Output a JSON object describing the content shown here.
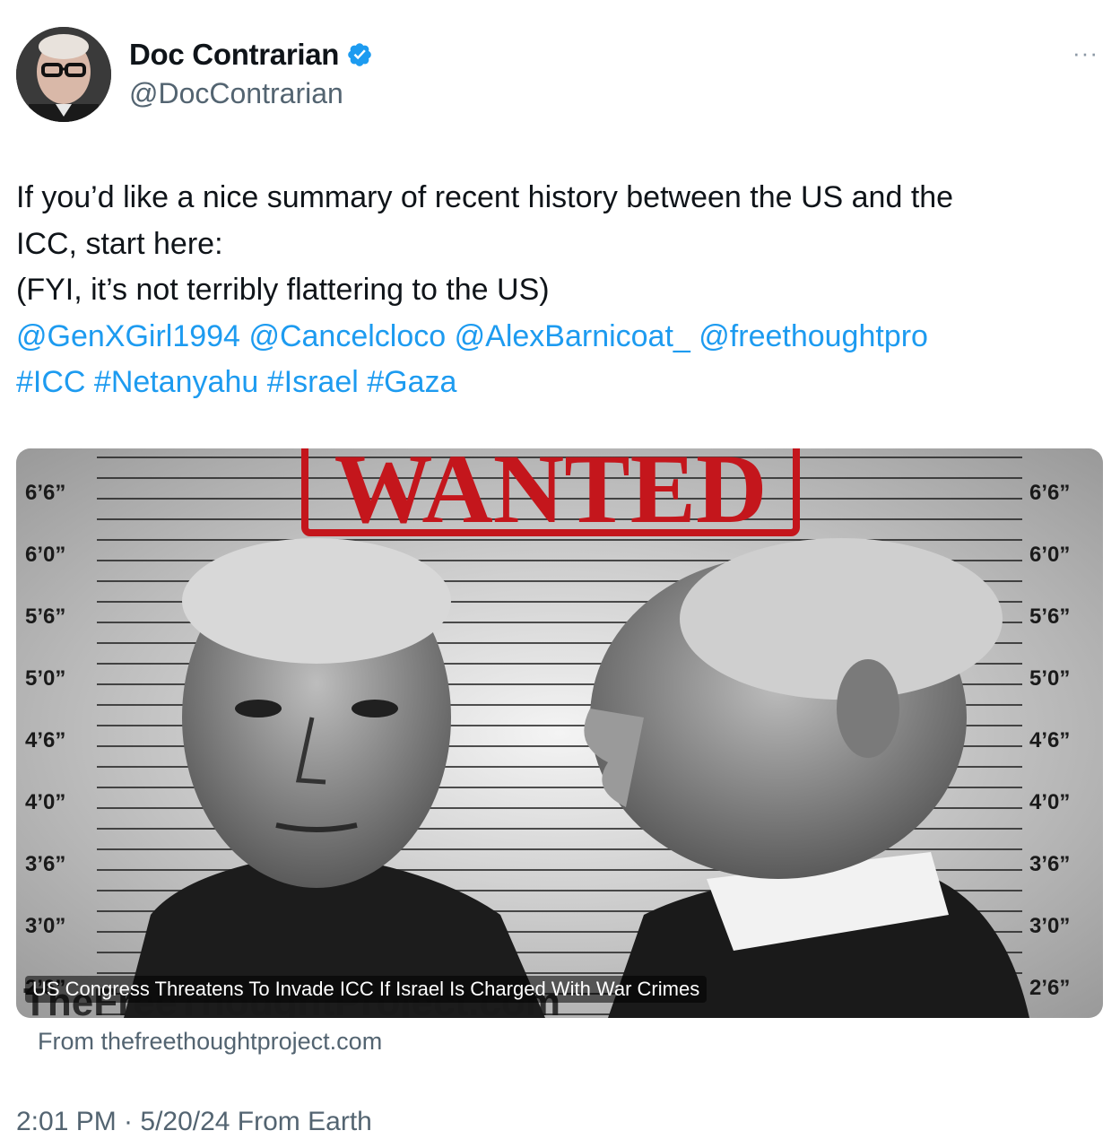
{
  "author": {
    "display_name": "Doc Contrarian",
    "handle": "@DocContrarian"
  },
  "more_label": "···",
  "tweet": {
    "line1": "If you’d like a nice summary of recent history between the US and the",
    "line2": "ICC, start here:",
    "line3": "(FYI, it’s not terribly flattering to the US)",
    "mentions": [
      "@GenXGirl1994",
      "@Cancelcloco",
      "@AlexBarnicoat_",
      "@freethoughtpro"
    ],
    "hashtags": [
      "#ICC",
      "#Netanyahu",
      "#Israel",
      "#Gaza"
    ]
  },
  "card": {
    "image_heading": "WANTED",
    "watermark": "TheFreeThoughtProject.com",
    "height_labels": [
      "6’6”",
      "6’0”",
      "5’6”",
      "5’0”",
      "4’6”",
      "4’0”",
      "3’6”",
      "3’0”",
      "2’6”"
    ],
    "caption": "US Congress Threatens To Invade ICC If Israel Is Charged With War Crimes",
    "source": "From thefreethoughtproject.com"
  },
  "timestamp": "2:01 PM · 5/20/24 From Earth",
  "colors": {
    "link": "#1d9bf0",
    "verified": "#1d9bf0",
    "secondary_text": "#536471",
    "wanted_red": "#c4161c"
  },
  "icons": {
    "verified": "verified-badge-icon",
    "more": "more-options-icon"
  }
}
